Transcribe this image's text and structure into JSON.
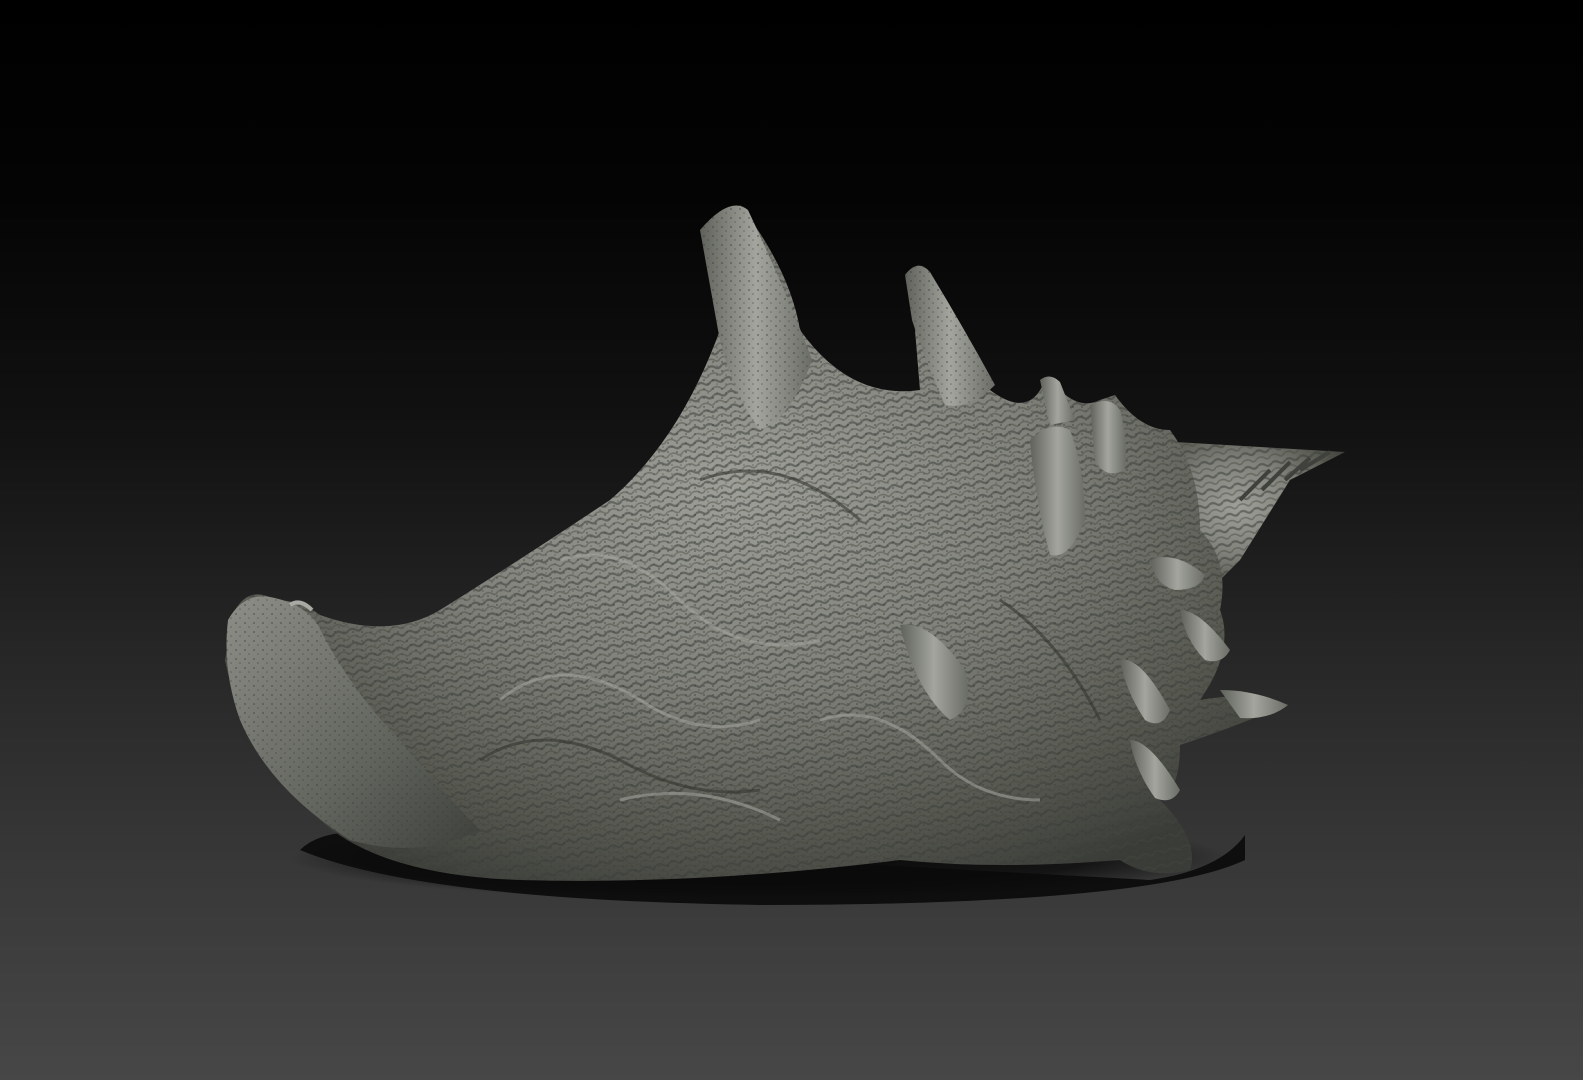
{
  "scene": {
    "subject": "conch-shell",
    "background_top": "#000000",
    "background_bottom": "#474747",
    "shell_highlight": "#9d9f98",
    "shell_midtone": "#6f716b",
    "shell_shadow": "#3a3c38",
    "ground_shadow": "#0b0b0b"
  }
}
